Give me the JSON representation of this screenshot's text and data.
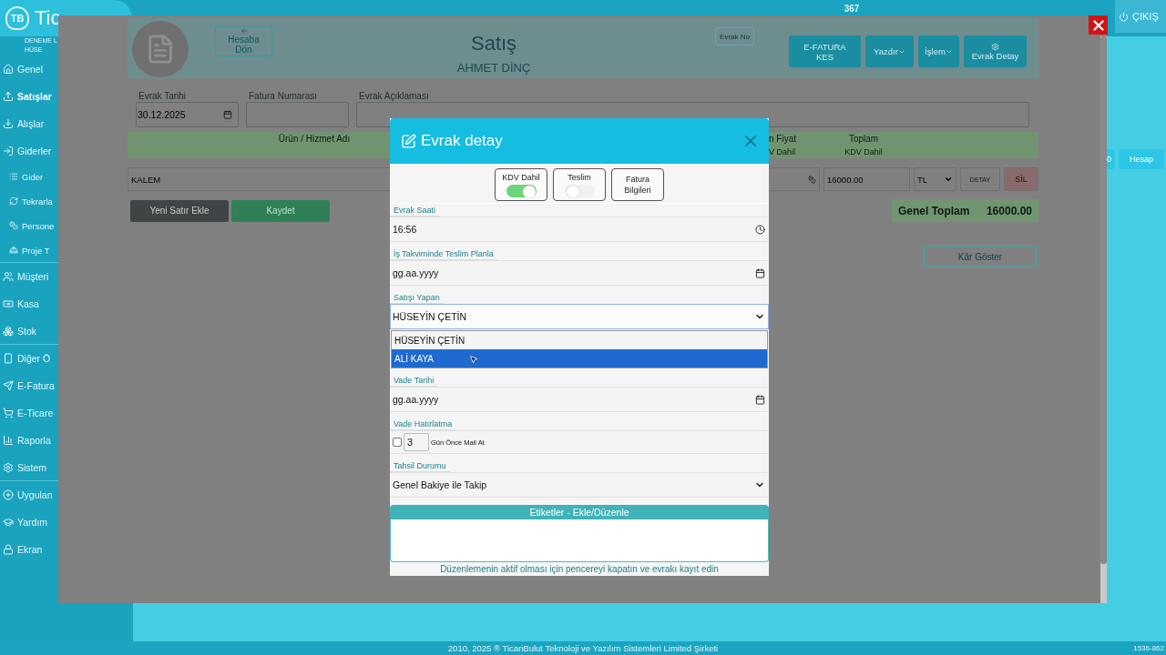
{
  "app": {
    "logo": "TB",
    "logo_text": "Tic",
    "user_lines": [
      "DENEME L",
      "HÜSE"
    ],
    "counter": "367",
    "logout": "ÇIKIŞ",
    "side_buttons": [
      "0",
      "Hesap"
    ],
    "footer": "2010, 2025 ® TicariBulut Teknoloji ve Yazılım Sistemleri Limited Şirketi",
    "corner_text": "1536-862"
  },
  "sidebar": {
    "items": [
      {
        "label": "Genel",
        "selected": false
      },
      {
        "label": "Satışlar",
        "selected": true
      },
      {
        "label": "Alışlar",
        "selected": false
      },
      {
        "label": "Giderler",
        "selected": false,
        "expanded": true,
        "children": [
          {
            "label": "Gider",
            "selected": false
          },
          {
            "label": "Tekrarla",
            "selected": false
          },
          {
            "label": "Persone",
            "selected": false
          },
          {
            "label": "Proje T",
            "selected": false
          }
        ]
      },
      {
        "label": "Müşteri",
        "selected": false,
        "divider": true
      },
      {
        "label": "Kasa",
        "selected": false
      },
      {
        "label": "Stok",
        "selected": false
      },
      {
        "label": "Diğer Ö",
        "selected": false,
        "divider": true
      },
      {
        "label": "E-Fatura",
        "selected": false
      },
      {
        "label": "E-Ticare",
        "selected": false
      },
      {
        "label": "Raporla",
        "selected": false
      },
      {
        "label": "Sistem",
        "selected": false
      },
      {
        "label": "Uygulan",
        "selected": false,
        "divider": true
      },
      {
        "label": "Yardım",
        "selected": false
      },
      {
        "label": "Ekran",
        "selected": false
      }
    ]
  },
  "page": {
    "back_button": "Hesaba Dön",
    "title": "Satış",
    "customer": "AHMET DİNÇ",
    "doc_no_button": "Evrak No",
    "actions": [
      {
        "label": "E-FATURA KES",
        "kind": "plain"
      },
      {
        "label": "Yazdır",
        "kind": "dropdown"
      },
      {
        "label": "İşlem",
        "kind": "dropdown"
      },
      {
        "label": "Evrak Detay",
        "kind": "gear"
      }
    ],
    "fields": [
      {
        "label": "Evrak Tarihi",
        "kind": "date",
        "value": "30.12.2025"
      },
      {
        "label": "Fatura Numarası",
        "kind": "text"
      },
      {
        "label": "Evrak Açıklaması",
        "kind": "textarea"
      }
    ],
    "columns": [
      {
        "label": "Ürün / Hizmet Adı"
      },
      {
        "label": "n Fiyat",
        "sub": "V Dahil"
      },
      {
        "label": "Toplam",
        "sub": "KDV Dahil"
      }
    ],
    "item_row": {
      "product": "KALEM",
      "price": "16000.00",
      "currency": "TL",
      "detail_button": "DETAY",
      "delete_button": "SİL"
    },
    "add_row_button": "Yeni Satır Ekle",
    "save_button": "Kaydet",
    "grand_total_label": "Genel Toplam",
    "grand_total": "16000.00",
    "profit_button": "Kâr Göster"
  },
  "modal": {
    "title": "Evrak detay",
    "toggles": [
      {
        "label": "KDV Dahil",
        "kind": "switch",
        "on": true
      },
      {
        "label": "Teslim",
        "kind": "switch",
        "on": false
      },
      {
        "label": "Fatura Bilgileri",
        "kind": "button"
      }
    ],
    "fields": [
      {
        "label": "Evrak Saati",
        "kind": "time",
        "value": "16:56"
      },
      {
        "label": "İş Takviminde Teslim Planla",
        "kind": "date",
        "placeholder": "gg.aa.yyyy"
      },
      {
        "label": "Satışı Yapan",
        "kind": "select",
        "value": "HÜSEYİN ÇETİN",
        "expanded": true,
        "options": [
          {
            "label": "HÜSEYİN ÇETİN",
            "selected": true,
            "highlighted": false
          },
          {
            "label": "ALİ KAYA",
            "selected": false,
            "highlighted": true
          }
        ]
      },
      {
        "label": "Vade Tarihi",
        "kind": "date",
        "placeholder": "gg.aa.yyyy"
      },
      {
        "label": "Vade Hatırlatma",
        "kind": "reminder",
        "checked": false,
        "days": "3",
        "suffix": "Gün Önce Mail At"
      },
      {
        "label": "Tahsil Durumu",
        "kind": "select",
        "value": "Genel Bakiye ile Takip",
        "expanded": false
      }
    ],
    "tags_header": "Etiketler - Ekle/Düzenle",
    "note": "Düzenlemenin aktif olması için pencereyi kapatın ve evrakı kayıt edin"
  }
}
